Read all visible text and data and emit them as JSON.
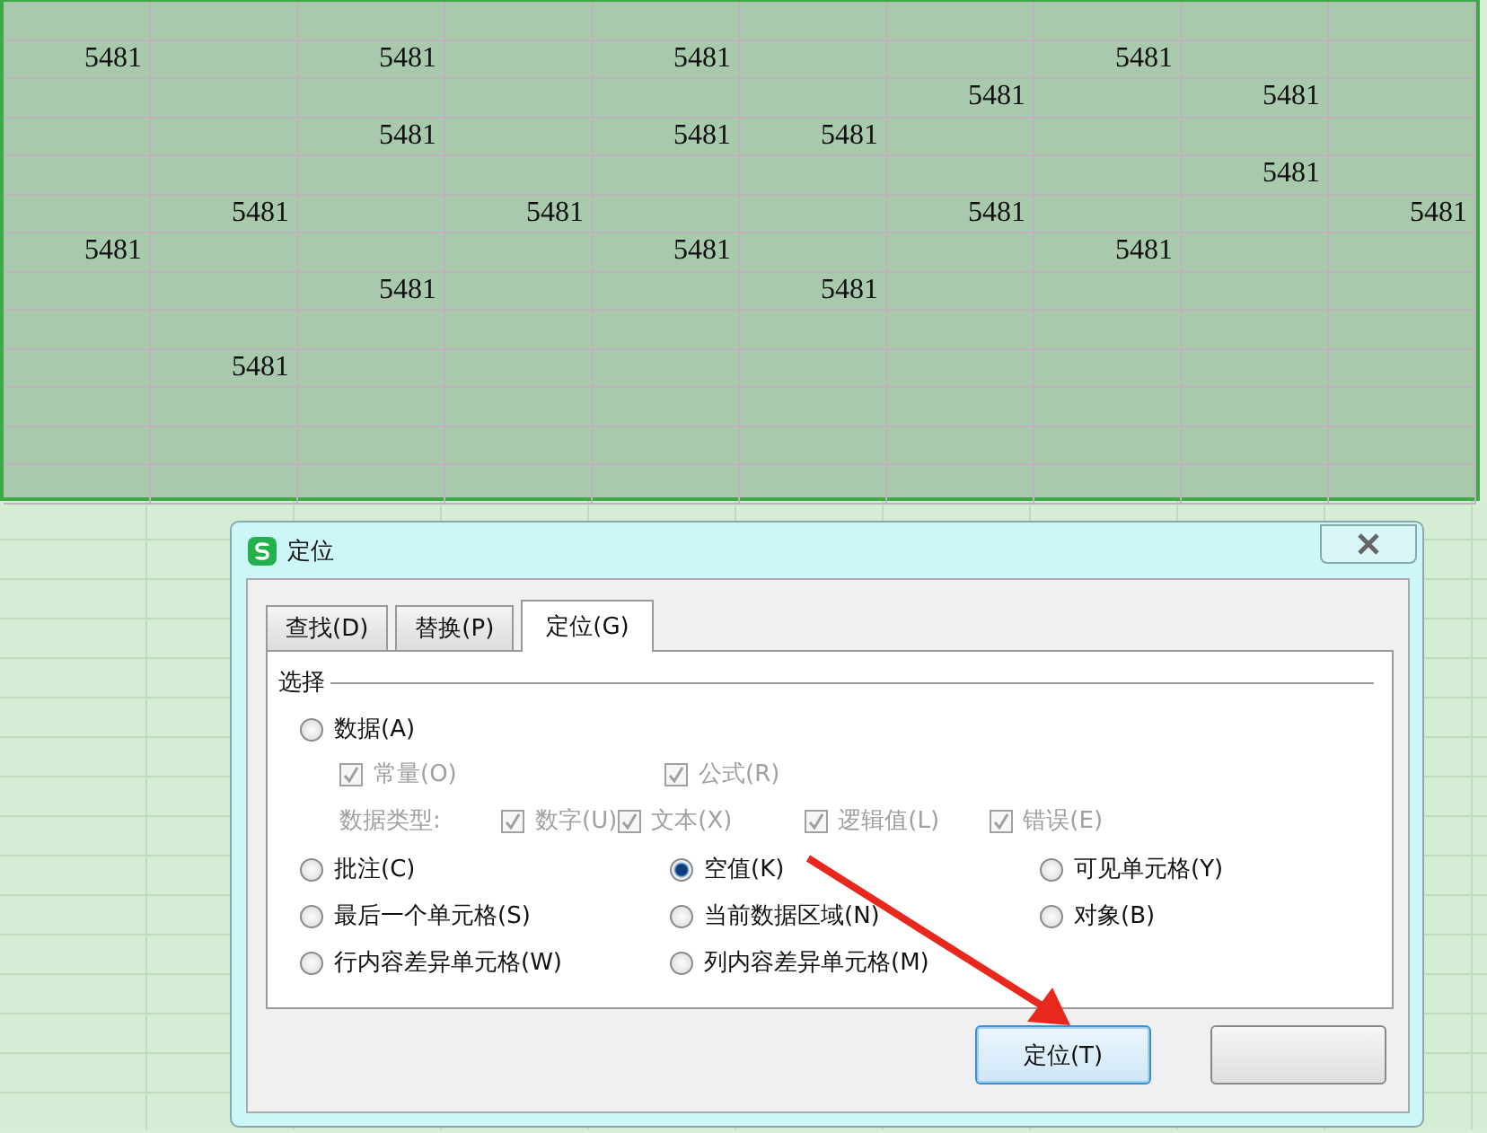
{
  "sheet": {
    "rows": [
      [
        null,
        null,
        null,
        null,
        null,
        null,
        null,
        null,
        null,
        null
      ],
      [
        "5481",
        null,
        "5481",
        null,
        "5481",
        null,
        null,
        "5481",
        null,
        null
      ],
      [
        null,
        null,
        null,
        null,
        null,
        null,
        "5481",
        null,
        "5481",
        null
      ],
      [
        null,
        null,
        "5481",
        null,
        "5481",
        "5481",
        null,
        null,
        null,
        null
      ],
      [
        null,
        null,
        null,
        null,
        null,
        null,
        null,
        null,
        "5481",
        null
      ],
      [
        null,
        "5481",
        null,
        "5481",
        null,
        null,
        "5481",
        null,
        null,
        "5481"
      ],
      [
        "5481",
        null,
        null,
        null,
        "5481",
        null,
        null,
        "5481",
        null,
        null
      ],
      [
        null,
        null,
        "5481",
        null,
        null,
        "5481",
        null,
        null,
        null,
        null
      ],
      [
        null,
        null,
        null,
        null,
        null,
        null,
        null,
        null,
        null,
        null
      ],
      [
        null,
        "5481",
        null,
        null,
        null,
        null,
        null,
        null,
        null,
        null
      ],
      [
        null,
        null,
        null,
        null,
        null,
        null,
        null,
        null,
        null,
        null
      ],
      [
        null,
        null,
        null,
        null,
        null,
        null,
        null,
        null,
        null,
        null
      ],
      [
        null,
        null,
        null,
        null,
        null,
        null,
        null,
        null,
        null,
        null
      ]
    ]
  },
  "dialog": {
    "title": "定位",
    "tabs": [
      {
        "label": "查找(D)",
        "selected": false
      },
      {
        "label": "替换(P)",
        "selected": false
      },
      {
        "label": "定位(G)",
        "selected": true
      }
    ],
    "group_label": "选择",
    "data_option": {
      "label": "数据(A)",
      "selected": false
    },
    "sub_checks": [
      {
        "label": "常量(O)",
        "checked": true,
        "disabled": true
      },
      {
        "label": "公式(R)",
        "checked": true,
        "disabled": true
      }
    ],
    "data_types": {
      "label": "数据类型:",
      "checks": [
        {
          "label": "数字(U)",
          "checked": true,
          "disabled": true
        },
        {
          "label": "文本(X)",
          "checked": true,
          "disabled": true
        },
        {
          "label": "逻辑值(L)",
          "checked": true,
          "disabled": true
        },
        {
          "label": "错误(E)",
          "checked": true,
          "disabled": true
        }
      ]
    },
    "radios": [
      {
        "label": "批注(C)",
        "selected": false
      },
      {
        "label": "空值(K)",
        "selected": true
      },
      {
        "label": "可见单元格(Y)",
        "selected": false
      },
      {
        "label": "最后一个单元格(S)",
        "selected": false
      },
      {
        "label": "当前数据区域(N)",
        "selected": false
      },
      {
        "label": "对象(B)",
        "selected": false
      },
      {
        "label": "行内容差异单元格(W)",
        "selected": false
      },
      {
        "label": "列内容差异单元格(M)",
        "selected": false
      }
    ],
    "buttons": [
      {
        "label": "定位(T)",
        "focused": true
      },
      {
        "focused": false
      }
    ]
  }
}
